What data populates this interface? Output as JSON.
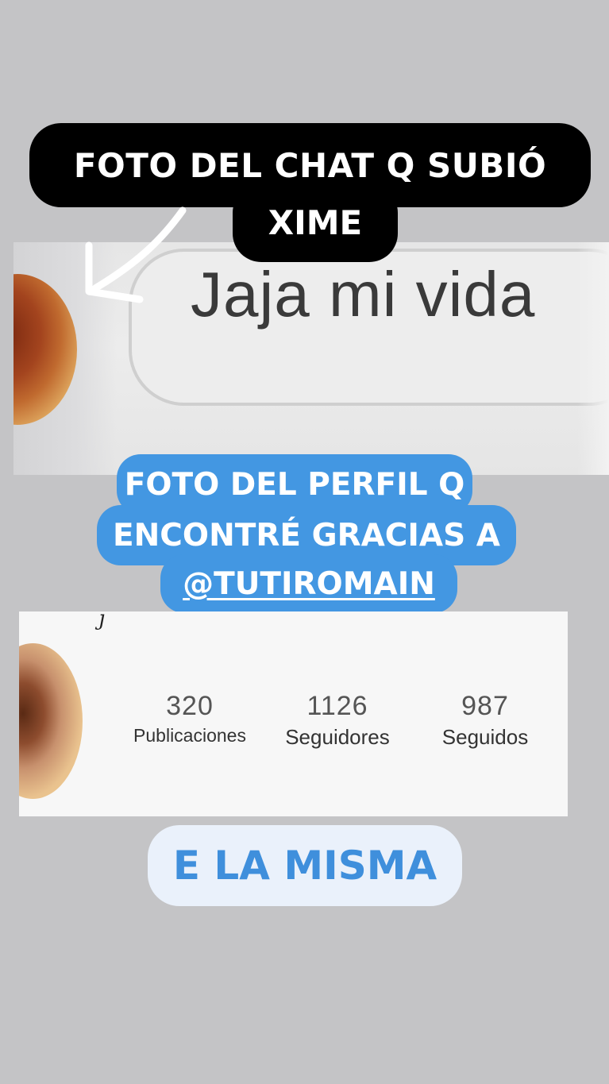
{
  "story": {
    "top_label_line1": "FOTO DEL CHAT Q SUBIÓ",
    "top_label_line2": "XIME",
    "chat_message": "Jaja mi vida",
    "blue_label_line1": "FOTO DEL PERFIL Q",
    "blue_label_line2": "ENCONTRÉ GRACIAS A",
    "blue_label_mention": "@TUTIROMAIN",
    "bottom_label": "E LA MISMA"
  },
  "profile": {
    "stats": [
      {
        "value": "320",
        "label": "Publicaciones"
      },
      {
        "value": "1126",
        "label": "Seguidores"
      },
      {
        "value": "987",
        "label": "Seguidos"
      }
    ]
  },
  "colors": {
    "background": "#c4c4c6",
    "black_label": "#000000",
    "blue_label": "#4397e2",
    "light_label_bg": "#eaf1fb",
    "light_label_text": "#3f8fdc"
  },
  "icons": {
    "arrow": "curved-arrow-icon"
  }
}
